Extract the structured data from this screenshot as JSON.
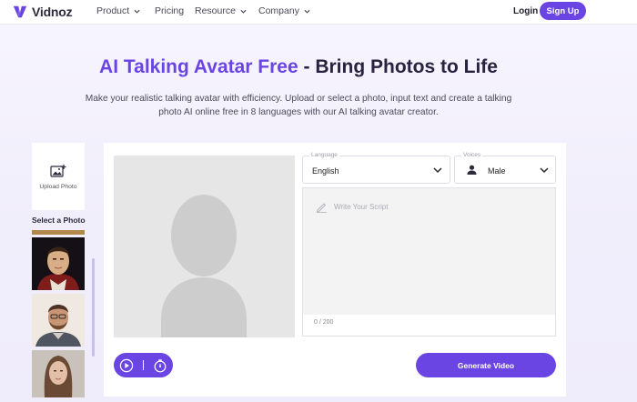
{
  "brand": {
    "name": "Vidnoz",
    "accent": "#6a45e4"
  },
  "nav": {
    "items": [
      {
        "label": "Product",
        "has_dropdown": true
      },
      {
        "label": "Pricing",
        "has_dropdown": false
      },
      {
        "label": "Resource",
        "has_dropdown": true
      },
      {
        "label": "Company",
        "has_dropdown": true
      }
    ],
    "login": "Login",
    "signup": "Sign Up"
  },
  "hero": {
    "title_accent": "AI Talking Avatar Free",
    "title_rest": " - Bring Photos to Life",
    "subtitle": "Make your realistic talking avatar with efficiency. Upload or select a photo, input text and create a talking photo AI online free in 8 languages with our AI talking avatar creator."
  },
  "photos": {
    "upload_label": "Upload Photo",
    "select_label": "Select a Photo",
    "thumbnails": [
      "portrait-painting",
      "man-with-beard",
      "woman-portrait"
    ]
  },
  "editor": {
    "language": {
      "label": "Language",
      "value": "English"
    },
    "voices": {
      "label": "Voices",
      "value": "Male"
    },
    "script_placeholder": "Write Your Script",
    "char_count": "0 / 200",
    "generate": "Generate Video"
  }
}
